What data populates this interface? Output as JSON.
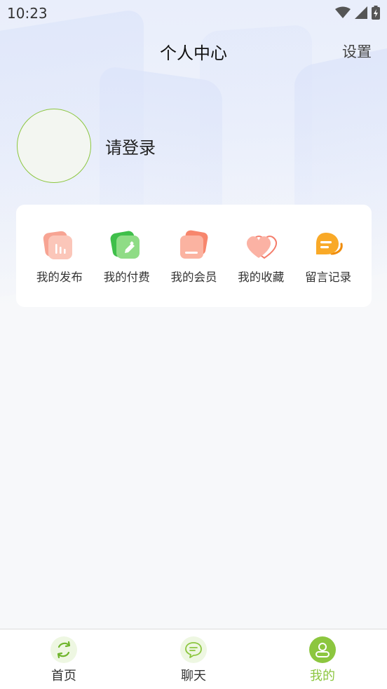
{
  "status_bar": {
    "time": "10:23"
  },
  "header": {
    "title": "个人中心",
    "settings_label": "设置"
  },
  "profile": {
    "login_text": "请登录"
  },
  "menu": {
    "items": [
      {
        "label": "我的发布",
        "icon": "bar-chart-icon"
      },
      {
        "label": "我的付费",
        "icon": "edit-icon"
      },
      {
        "label": "我的会员",
        "icon": "member-card-icon"
      },
      {
        "label": "我的收藏",
        "icon": "heart-icon"
      },
      {
        "label": "留言记录",
        "icon": "chat-bubble-icon"
      }
    ]
  },
  "tabbar": {
    "items": [
      {
        "label": "首页",
        "icon": "refresh-icon",
        "active": false
      },
      {
        "label": "聊天",
        "icon": "chat-icon",
        "active": false
      },
      {
        "label": "我的",
        "icon": "user-icon",
        "active": true
      }
    ]
  },
  "colors": {
    "accent": "#8cc63f",
    "card_bg": "#ffffff",
    "page_bg": "#f7f8fa"
  }
}
